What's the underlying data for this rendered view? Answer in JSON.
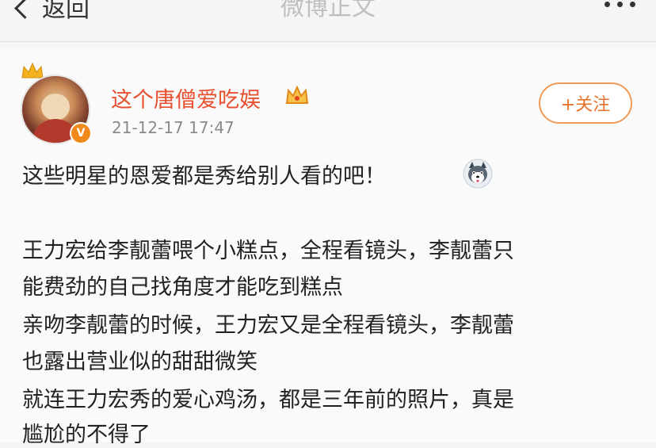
{
  "nav": {
    "back_label": "返回",
    "title": "微博正文"
  },
  "post": {
    "username": "这个唐僧爱吃娱",
    "timestamp": "21-12-17 17:47",
    "follow_label": "+关注",
    "lines": [
      "这些明星的恩爱都是秀给别人看的吧！",
      "王力宏给李靓蕾喂个小糕点，全程看镜头，李靓蕾只",
      "能费劲的自己找角度才能吃到糕点",
      "亲吻李靓蕾的时候，王力宏又是全程看镜头，李靓蕾",
      "也露出营业似的甜甜微笑",
      "就连王力宏秀的爱心鸡汤，都是三年前的照片，真是",
      "尴尬的不得了"
    ]
  },
  "colors": {
    "username": "#e8502f",
    "follow_border": "#f09a57",
    "nav_title": "#bfbfbf"
  }
}
